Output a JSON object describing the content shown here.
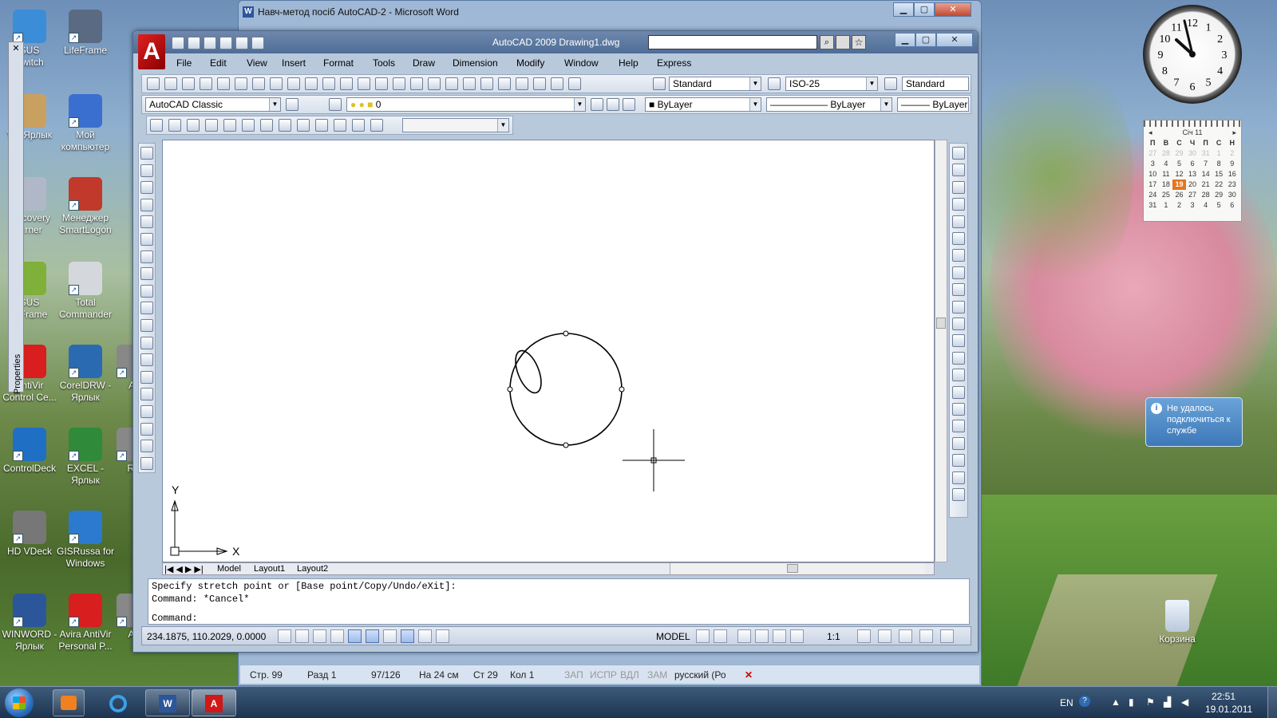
{
  "desktop": {
    "icons": [
      {
        "label": "SUS\nSwitch",
        "color": "#3c8dd8"
      },
      {
        "label": "LifeFrame",
        "color": "#5a6a82"
      },
      {
        "label": "V... Ярлык",
        "color": "#c8a060"
      },
      {
        "label": "Мой\nкомпьютер",
        "color": "#3a6fd0"
      },
      {
        "label": "...ecovery\n...rner",
        "color": "#b0b8c8"
      },
      {
        "label": "Менеджер\nSmartLogon",
        "color": "#c0392b"
      },
      {
        "label": "SUS\n...Frame",
        "color": "#7fb03a"
      },
      {
        "label": "Total\nCommander",
        "color": "#d4d8dc"
      },
      {
        "label": "AntiVir\nControl Ce...",
        "color": "#d81e1e"
      },
      {
        "label": "CorelDRW -\nЯрлык",
        "color": "#2a6ab0"
      },
      {
        "label": "ControlDeck",
        "color": "#1f6fc4"
      },
      {
        "label": "EXCEL -\nЯрлык",
        "color": "#2f8a3a"
      },
      {
        "label": "HD VDeck",
        "color": "#777"
      },
      {
        "label": "GISRussa for\nWindows",
        "color": "#2c7ad0"
      },
      {
        "label": "WINWORD -\nЯрлык",
        "color": "#2b579a"
      },
      {
        "label": "Avira AntiVir\nPersonal P...",
        "color": "#d81e1e"
      },
      {
        "label": "All",
        "color": "#888"
      },
      {
        "label": "Ar",
        "color": "#888"
      },
      {
        "label": "Re",
        "color": "#888"
      }
    ],
    "recycle_bin": "Корзина",
    "properties_label": "Properties"
  },
  "word": {
    "title": "Навч-метод посіб AutoCAD-2 - Microsoft Word",
    "status": {
      "page": "Стр. 99",
      "section": "Разд 1",
      "pages": "97/126",
      "at": "На 24 см",
      "line": "Ст 29",
      "col": "Кол 1",
      "rec": "ЗАП",
      "trk": "ИСПР",
      "ext": "ВДЛ",
      "ovr": "ЗАМ",
      "lang": "русский (Ро"
    }
  },
  "acad": {
    "title": "AutoCAD 2009  Drawing1.dwg",
    "menu": [
      "File",
      "Edit",
      "View",
      "Insert",
      "Format",
      "Tools",
      "Draw",
      "Dimension",
      "Modify",
      "Window",
      "Help",
      "Express"
    ],
    "text_style": "Standard",
    "dim_style": "ISO-25",
    "table_style": "Standard",
    "workspace": "AutoCAD Classic",
    "layer": "0",
    "color": "ByLayer",
    "linetype": "ByLayer",
    "lineweight": "ByLayer",
    "tabs": [
      "Model",
      "Layout1",
      "Layout2"
    ],
    "axis_x": "X",
    "axis_y": "Y",
    "command_lines": [
      "Specify stretch point or [Base point/Copy/Undo/eXit]:",
      "Command: *Cancel*"
    ],
    "command_prompt": "Command:",
    "coords": "234.1875, 110.2029, 0.0000",
    "model": "MODEL",
    "scale": "1:1"
  },
  "gadgets": {
    "calendar_title": "Січ 11",
    "weekdays": [
      "П",
      "В",
      "С",
      "Ч",
      "П",
      "С",
      "Н"
    ],
    "weeks": [
      [
        "27",
        "28",
        "29",
        "30",
        "31",
        "1",
        "2"
      ],
      [
        "3",
        "4",
        "5",
        "6",
        "7",
        "8",
        "9"
      ],
      [
        "10",
        "11",
        "12",
        "13",
        "14",
        "15",
        "16"
      ],
      [
        "17",
        "18",
        "19",
        "20",
        "21",
        "22",
        "23"
      ],
      [
        "24",
        "25",
        "26",
        "27",
        "28",
        "29",
        "30"
      ],
      [
        "31",
        "1",
        "2",
        "3",
        "4",
        "5",
        "6"
      ]
    ],
    "today": "19",
    "clock_numbers": [
      "12",
      "1",
      "2",
      "3",
      "4",
      "5",
      "6",
      "7",
      "8",
      "9",
      "10",
      "11"
    ],
    "notice": "Не удалось подключиться к службе"
  },
  "taskbar": {
    "lang": "EN",
    "time": "22:51",
    "date": "19.01.2011"
  },
  "colors": {
    "acad_red": "#d01818",
    "word_blue": "#2b579a",
    "today": "#e8751a"
  }
}
